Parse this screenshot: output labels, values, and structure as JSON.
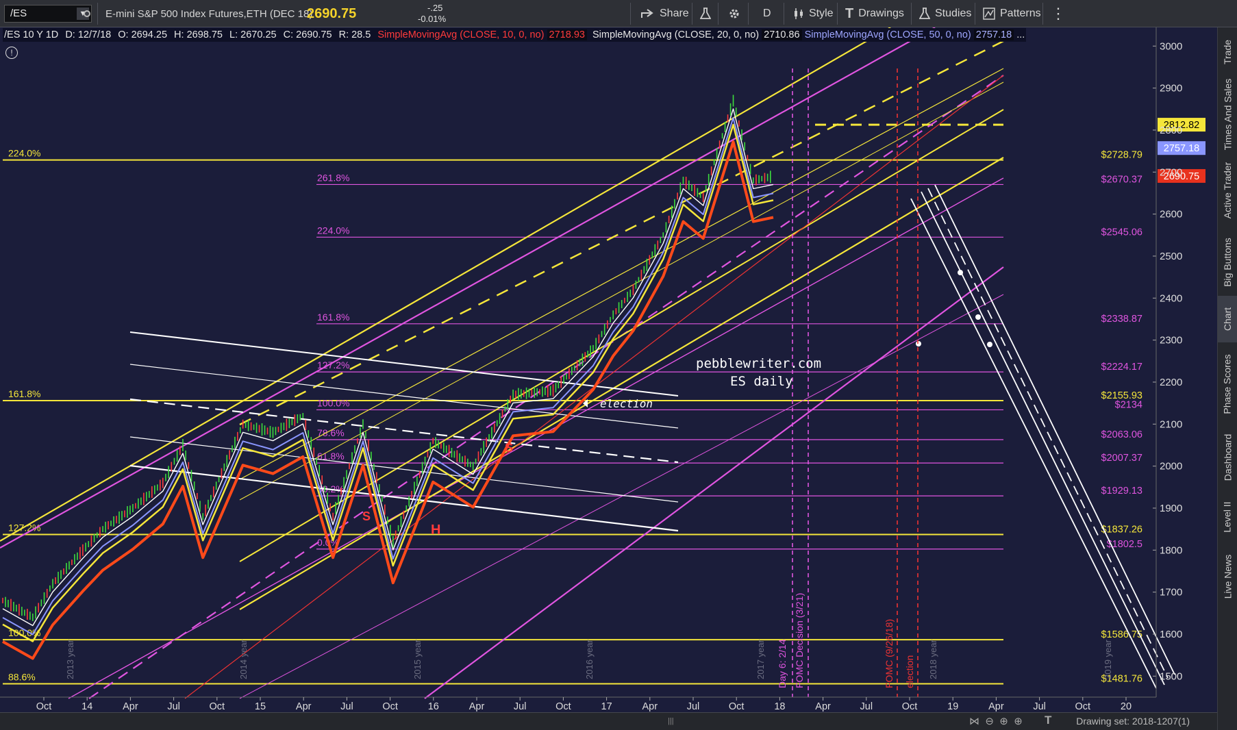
{
  "toolbar": {
    "symbol": "/ES",
    "description": "E-mini S&P 500 Index Futures,ETH (DEC 18)",
    "price": "2690.75",
    "change": "-.25",
    "change_pct": "-0.01%",
    "share": "Share",
    "timeframe": "D",
    "style": "Style",
    "drawings": "Drawings",
    "studies": "Studies",
    "patterns": "Patterns"
  },
  "legend": {
    "header": "/ES 10 Y 1D",
    "date": "D: 12/7/18",
    "open": "O: 2694.25",
    "high": "H: 2698.75",
    "low": "L: 2670.25",
    "close": "C: 2690.75",
    "range": "R: 28.5",
    "sma10": "SimpleMovingAvg (CLOSE, 10, 0, no)",
    "sma10_val": "2718.93",
    "sma20": "SimpleMovingAvg (CLOSE, 20, 0, no)",
    "sma20_val": "2710.86",
    "sma50": "SimpleMovingAvg (CLOSE, 50, 0, no)",
    "sma50_val": "2757.18",
    "more": "..."
  },
  "side_tabs": [
    "Trade",
    "Times And Sales",
    "Active Trader",
    "Big Buttons",
    "Chart",
    "Phase Scores",
    "Dashboard",
    "Level II",
    "Live News"
  ],
  "status": {
    "drawing_set": "Drawing set: 2018-1207(1)"
  },
  "colors": {
    "background": "#1b1d3a",
    "yellow": "#f5e63a",
    "magenta": "#e055e0",
    "red_sma": "#ff4a1a",
    "blue_sma": "#8a96ff",
    "white": "#ffffff",
    "current_price": "#e8321e"
  },
  "chart_data": {
    "type": "line",
    "symbol": "/ES",
    "timeframe": "1D",
    "ylim": [
      1450,
      3020
    ],
    "y_ticks": [
      1500,
      1600,
      1700,
      1800,
      1900,
      2000,
      2100,
      2200,
      2300,
      2400,
      2500,
      2600,
      2700,
      2800,
      2900,
      3000
    ],
    "x_ticks": [
      "Oct",
      "14",
      "Apr",
      "Jul",
      "Oct",
      "15",
      "Apr",
      "Jul",
      "Oct",
      "16",
      "Apr",
      "Jul",
      "Oct",
      "17",
      "Apr",
      "Jul",
      "Oct",
      "18",
      "Apr",
      "Jul",
      "Oct",
      "19",
      "Apr",
      "Jul",
      "Oct",
      "20"
    ],
    "year_labels": [
      "2013 year",
      "2014 year",
      "2015 year",
      "2016 year",
      "2017 year",
      "2018 year",
      "2019 year"
    ],
    "price_path": {
      "x": [
        0,
        3,
        5,
        8,
        10,
        13,
        16,
        18,
        20,
        24,
        27,
        30,
        33,
        36,
        39,
        43,
        47,
        51,
        55,
        59,
        61,
        63,
        66,
        68,
        70,
        73,
        75,
        77
      ],
      "y": [
        1680,
        1640,
        1720,
        1800,
        1850,
        1900,
        1960,
        2050,
        1880,
        2100,
        2080,
        2120,
        1880,
        2100,
        1820,
        2060,
        2000,
        2170,
        2180,
        2280,
        2360,
        2420,
        2550,
        2680,
        2640,
        2870,
        2680,
        2690
      ]
    },
    "series": [
      {
        "name": "SimpleMovingAvg (CLOSE, 10, 0, no)",
        "color": "#ff3b3b",
        "last": 2718.93
      },
      {
        "name": "SimpleMovingAvg (CLOSE, 20, 0, no)",
        "color": "#ffffff",
        "last": 2710.86
      },
      {
        "name": "SimpleMovingAvg (CLOSE, 50, 0, no)",
        "color": "#8a96ff",
        "last": 2757.18
      }
    ],
    "price_levels": [
      {
        "label": "$2728.79",
        "value": 2728.79,
        "color": "#f5e63a"
      },
      {
        "label": "$2670.37",
        "value": 2670.37,
        "color": "#e055e0"
      },
      {
        "label": "$2545.06",
        "value": 2545.06,
        "color": "#e055e0"
      },
      {
        "label": "$2338.87",
        "value": 2338.87,
        "color": "#e055e0"
      },
      {
        "label": "$2224.17",
        "value": 2224.17,
        "color": "#e055e0"
      },
      {
        "label": "$2155.93",
        "value": 2155.93,
        "color": "#f5e63a"
      },
      {
        "label": "$2134",
        "value": 2134,
        "color": "#e055e0"
      },
      {
        "label": "$2063.06",
        "value": 2063.06,
        "color": "#e055e0"
      },
      {
        "label": "$2007.37",
        "value": 2007.37,
        "color": "#e055e0"
      },
      {
        "label": "$1929.13",
        "value": 1929.13,
        "color": "#e055e0"
      },
      {
        "label": "$1837.26",
        "value": 1837.26,
        "color": "#f5e63a"
      },
      {
        "label": "$1802.5",
        "value": 1802.5,
        "color": "#e055e0"
      },
      {
        "label": "$1586.75",
        "value": 1586.75,
        "color": "#f5e63a"
      },
      {
        "label": "$1481.76",
        "value": 1481.76,
        "color": "#f5e63a"
      }
    ],
    "price_tags": [
      {
        "label": "2812.82",
        "value": 2812.82,
        "bg": "#f5e63a",
        "fg": "#000000"
      },
      {
        "label": "2757.18",
        "value": 2757.18,
        "bg": "#8a96ff",
        "fg": "#ffffff"
      },
      {
        "label": "2690.75",
        "value": 2690.75,
        "bg": "#e8321e",
        "fg": "#ffffff"
      }
    ],
    "fib_yellow": [
      {
        "label": "224.0%",
        "value": 2728.79
      },
      {
        "label": "161.8%",
        "value": 2155.93
      },
      {
        "label": "127.2%",
        "value": 1837.26
      },
      {
        "label": "100.0%",
        "value": 1586.75
      },
      {
        "label": "88.6%",
        "value": 1481.76
      }
    ],
    "fib_magenta": [
      {
        "label": "261.8%",
        "value": 2670.37
      },
      {
        "label": "224.0%",
        "value": 2545.06
      },
      {
        "label": "161.8%",
        "value": 2338.87
      },
      {
        "label": "127.2%",
        "value": 2224.17
      },
      {
        "label": "100.0%",
        "value": 2134
      },
      {
        "label": "78.6%",
        "value": 2063.06
      },
      {
        "label": "61.8%",
        "value": 2007.37
      },
      {
        "label": "38.2%",
        "value": 1929.13
      },
      {
        "label": "0.0%",
        "value": 1802.5
      }
    ],
    "annotations": {
      "site": "pebblewriter.com",
      "sub": "ES daily",
      "election": "election",
      "election2": "election",
      "day6": "Day 6: 2/14",
      "fomc1": "FOMC Decision (3/21)",
      "fomc2": "FOMC (9/26/18)",
      "s1": "S",
      "s2": "S",
      "h1": "H"
    }
  }
}
